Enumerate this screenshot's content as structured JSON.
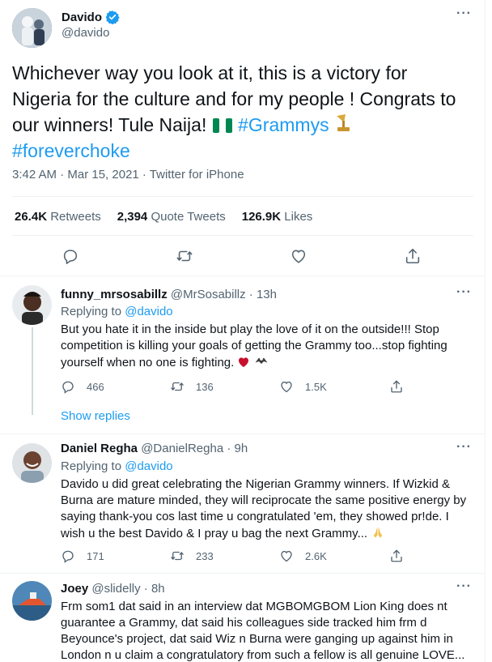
{
  "main_tweet": {
    "author_name": "Davido",
    "author_handle": "@davido",
    "text_line1": "Whichever way you look at it, this is a victory for",
    "text_line2": "Nigeria for the culture and for my people !  Congrats to",
    "text_line3_plain": "our winners! Tule Naija!",
    "hashtag_grammys": "#Grammys",
    "hashtag_foreverchoke": "#foreverchoke",
    "timestamp": "3:42 AM · Mar 15, 2021 · Twitter for iPhone",
    "retweets_count": "26.4K",
    "retweets_label": "Retweets",
    "quote_count": "2,394",
    "quote_label": "Quote Tweets",
    "likes_count": "126.9K",
    "likes_label": "Likes",
    "icons": [
      "reply-icon",
      "retweet-icon",
      "like-icon",
      "share-icon"
    ]
  },
  "replies": [
    {
      "name": "funny_mrsosabillz",
      "handle": "@MrSosabillz",
      "time": "13h",
      "replying_label": "Replying to",
      "replying_to": "@davido",
      "text_line1": "But you hate it in the inside but play the love of it on the outside!!! Stop",
      "text_line2": "competition is killing your goals of getting the Grammy too...stop fighting",
      "text_line3": "yourself when no one is fighting.",
      "reply_count": "466",
      "retweet_count": "136",
      "like_count": "1.5K",
      "show_replies": "Show replies"
    },
    {
      "name": "Daniel Regha",
      "handle": "@DanielRegha",
      "time": "9h",
      "replying_label": "Replying to",
      "replying_to": "@davido",
      "text_line1": "Davido u did great celebrating the Nigerian Grammy winners. If Wizkid &",
      "text_line2": "Burna are mature minded, they will reciprocate the same positive energy by",
      "text_line3": "saying thank-you cos last time u congratulated 'em, they showed pr!de. I",
      "text_line4": "wish u the best Davido & I pray u bag the next Grammy...",
      "reply_count": "171",
      "retweet_count": "233",
      "like_count": "2.6K"
    },
    {
      "name": "Joey",
      "handle": "@slidelly",
      "time": "8h",
      "text_line1": "Frm som1 dat said in an interview dat MGBOMGBOM Lion King does nt",
      "text_line2": "guarantee a Grammy, dat said his colleagues side tracked him frm d",
      "text_line3": "Beyounce's project, dat said Wiz n Burna were ganging up against him in",
      "text_line4": "London n u claim a congratulatory from such a fellow is all genuine LOVE..."
    }
  ],
  "colors": {
    "accent": "#1d9bf0",
    "muted": "#536471",
    "text": "#0f1419",
    "heart": "#c8102e",
    "nigeria_green": "#008751"
  }
}
